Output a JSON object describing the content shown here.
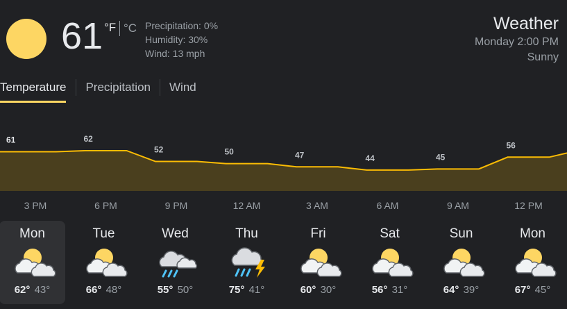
{
  "current": {
    "temperature": "61",
    "unit_f": "°F",
    "unit_c": "°C",
    "precipitation": "Precipitation: 0%",
    "humidity": "Humidity: 30%",
    "wind": "Wind: 13 mph",
    "icon": "sunny-icon"
  },
  "header": {
    "title": "Weather",
    "time": "Monday 2:00 PM",
    "condition": "Sunny"
  },
  "tabs": [
    "Temperature",
    "Precipitation",
    "Wind"
  ],
  "chart_data": {
    "type": "area",
    "x": [
      "3 PM",
      "6 PM",
      "9 PM",
      "12 AM",
      "3 AM",
      "6 AM",
      "9 AM",
      "12 PM"
    ],
    "values": [
      61,
      62,
      52,
      50,
      47,
      44,
      45,
      56
    ],
    "data_labels": [
      "61",
      "62",
      "52",
      "50",
      "47",
      "44",
      "45",
      "56"
    ],
    "line_color": "#fbbc04",
    "fill_color": "#4a3f1e"
  },
  "times": [
    "3 PM",
    "6 PM",
    "9 PM",
    "12 AM",
    "3 AM",
    "6 AM",
    "9 AM",
    "12 PM"
  ],
  "forecast": [
    {
      "day": "Mon",
      "high": "62°",
      "low": "43°",
      "icon": "partly-cloudy-icon"
    },
    {
      "day": "Tue",
      "high": "66°",
      "low": "48°",
      "icon": "partly-cloudy-icon"
    },
    {
      "day": "Wed",
      "high": "55°",
      "low": "50°",
      "icon": "rain-icon"
    },
    {
      "day": "Thu",
      "high": "75°",
      "low": "41°",
      "icon": "thunderstorm-icon"
    },
    {
      "day": "Fri",
      "high": "60°",
      "low": "30°",
      "icon": "partly-cloudy-icon"
    },
    {
      "day": "Sat",
      "high": "56°",
      "low": "31°",
      "icon": "partly-cloudy-icon"
    },
    {
      "day": "Sun",
      "high": "64°",
      "low": "39°",
      "icon": "partly-cloudy-icon"
    },
    {
      "day": "Mon",
      "high": "67°",
      "low": "45°",
      "icon": "partly-cloudy-icon"
    }
  ],
  "colors": {
    "accent": "#fdd663",
    "background": "#202124",
    "selected": "#303134"
  }
}
